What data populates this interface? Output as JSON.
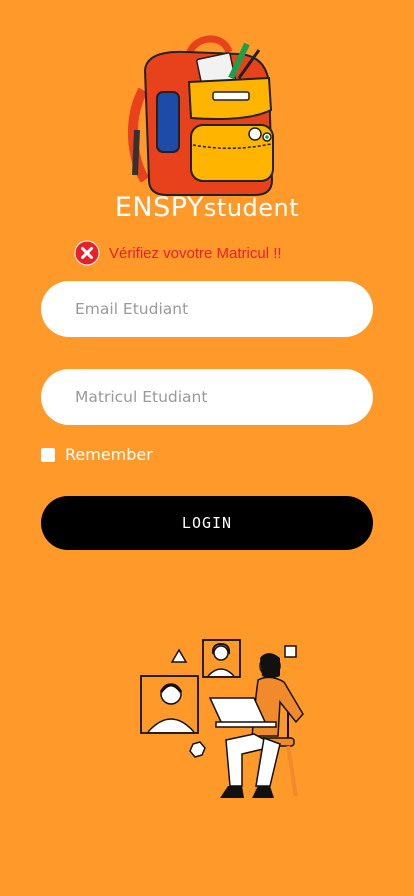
{
  "logo": {
    "icon": "backpack-logo",
    "brand_part1": "ENSPY",
    "brand_part2": "student"
  },
  "error": {
    "icon": "error-x-icon",
    "message": "Vérifiez vovotre Matricul !!",
    "color": "#E8202A"
  },
  "form": {
    "email_placeholder": "Email Etudiant",
    "matricul_placeholder": "Matricul Etudiant",
    "remember_label": "Remember",
    "remember_checked": false,
    "login_label": "LOGIN"
  },
  "illustration": {
    "icon": "remote-learning-illustration"
  },
  "colors": {
    "background": "#FF9A2A",
    "button": "#000000",
    "field": "#ffffff"
  }
}
